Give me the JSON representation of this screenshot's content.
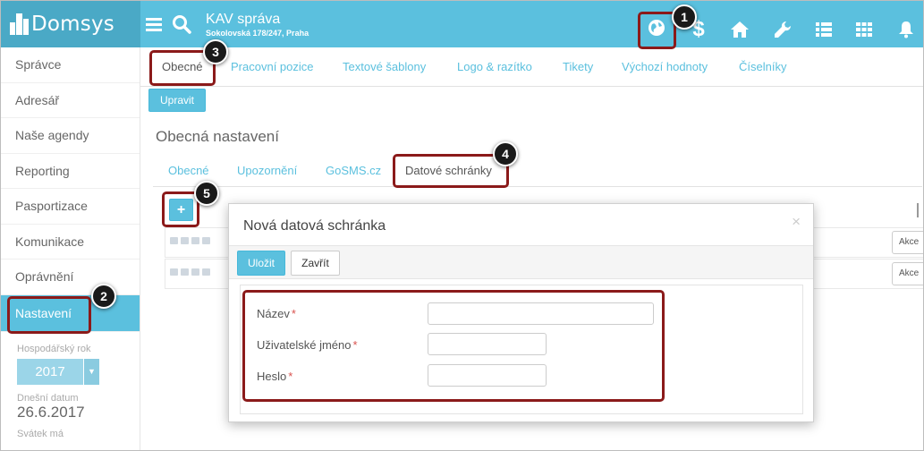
{
  "app": {
    "name": "Domsys"
  },
  "org": {
    "title": "KAV správa",
    "address": "Sokolovská 178/247, Praha"
  },
  "topbar_icons": [
    "menu-icon",
    "search-icon",
    "globe-icon",
    "dollar-icon",
    "home-icon",
    "wrench-icon",
    "list-icon",
    "grid-icon",
    "bell-icon"
  ],
  "sidebar": {
    "items": [
      {
        "label": "Správce"
      },
      {
        "label": "Adresář"
      },
      {
        "label": "Naše agendy"
      },
      {
        "label": "Reporting"
      },
      {
        "label": "Pasportizace"
      },
      {
        "label": "Komunikace"
      },
      {
        "label": "Oprávnění"
      },
      {
        "label": "Nastavení"
      }
    ],
    "fiscal_year_label": "Hospodářský rok",
    "fiscal_year": "2017",
    "today_label": "Dnešní datum",
    "today": "26.6.2017",
    "holiday_label": "Svátek má"
  },
  "main": {
    "tabs": [
      {
        "label": "Obecné"
      },
      {
        "label": "Pracovní pozice"
      },
      {
        "label": "Textové šablony"
      },
      {
        "label": "Logo & razítko"
      },
      {
        "label": "Tikety"
      },
      {
        "label": "Výchozí hodnoty"
      },
      {
        "label": "Číselníky"
      }
    ],
    "edit_button": "Upravit",
    "section_title": "Obecná nastavení",
    "subtabs": [
      {
        "label": "Obecné"
      },
      {
        "label": "Upozornění"
      },
      {
        "label": "GoSMS.cz"
      },
      {
        "label": "Datové schránky"
      }
    ],
    "add_button": "+",
    "actions_label": "Akce"
  },
  "modal": {
    "title": "Nová datová schránka",
    "close_glyph": "×",
    "save_button": "Uložit",
    "close_button": "Zavřít",
    "fields": [
      {
        "label": "Název",
        "required": "*",
        "value": ""
      },
      {
        "label": "Uživatelské jméno",
        "required": "*",
        "value": ""
      },
      {
        "label": "Heslo",
        "required": "*",
        "value": ""
      }
    ]
  },
  "callouts": [
    "1",
    "2",
    "3",
    "4",
    "5"
  ],
  "colors": {
    "accent": "#5bc0de",
    "logo_bg": "#4aa9c6",
    "highlight": "#8b1a1a",
    "required": "#d9534f"
  }
}
